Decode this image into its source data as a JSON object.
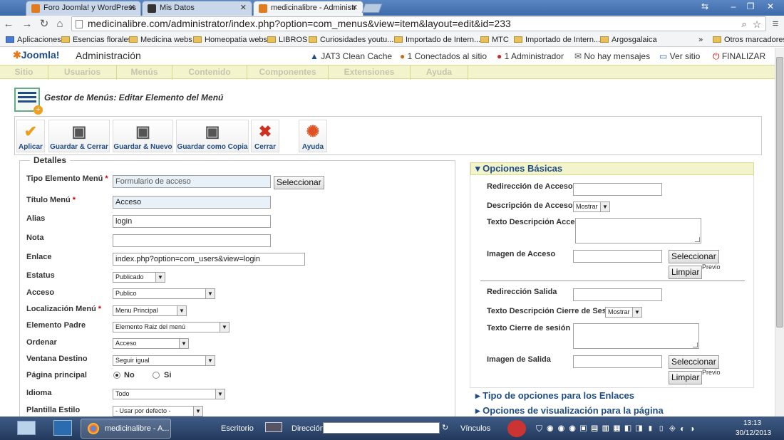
{
  "browser": {
    "tabs": [
      {
        "label": "Foro Joomla! y WordPress"
      },
      {
        "label": "Mis Datos"
      },
      {
        "label": "medicinalibre - Administr"
      }
    ],
    "url": "medicinalibre.com/administrator/index.php?option=com_menus&view=item&layout=edit&id=233",
    "bookmarks": [
      "Aplicaciones",
      "Esencias florales",
      "Medicina webs",
      "Homeopatia webs",
      "LIBROS",
      "Curiosidades youtu...",
      "Importado de Intern...",
      "MTC",
      "Importado de Intern...",
      "Argosgalaica"
    ],
    "other_bookmarks": "Otros marcadores"
  },
  "joomla": {
    "logo": "Joomla!",
    "admin": "Administración",
    "header_links": [
      "JAT3 Clean Cache",
      "1 Conectados al sitio",
      "1 Administrador",
      "No hay mensajes",
      "Ver sitio",
      "FINALIZAR"
    ],
    "menu": [
      "Sitio",
      "Usuarios",
      "Menús",
      "Contenido",
      "Componentes",
      "Extensiones",
      "Ayuda"
    ],
    "page_title": "Gestor de Menús: Editar Elemento del Menú",
    "toolbar": [
      "Aplicar",
      "Guardar & Cerrar",
      "Guardar & Nuevo",
      "Guardar como Copia",
      "Cerrar",
      "Ayuda"
    ]
  },
  "details": {
    "legend": "Detalles",
    "labels": {
      "tipo": "Tipo Elemento Menú",
      "titulo": "Título Menú",
      "alias": "Alias",
      "nota": "Nota",
      "enlace": "Enlace",
      "estatus": "Estatus",
      "acceso": "Acceso",
      "localizacion": "Localización Menú",
      "padre": "Elemento Padre",
      "ordenar": "Ordenar",
      "ventana": "Ventana Destino",
      "principal": "Página principal",
      "idioma": "Idioma",
      "plantilla": "Plantilla Estilo"
    },
    "values": {
      "tipo": "Formulario de acceso",
      "titulo": "Acceso",
      "alias": "login",
      "nota": "",
      "enlace": "index.php?option=com_users&view=login",
      "estatus": "Publicado",
      "acceso": "Publico",
      "localizacion": "Menu Principal",
      "padre": "Elemento Raiz del menú",
      "ordenar": "Acceso",
      "ventana": "Seguir igual",
      "idioma": "Todo",
      "plantilla": "- Usar por defecto -"
    },
    "principal_options": [
      "No",
      "Si"
    ],
    "select_button": "Seleccionar"
  },
  "options": {
    "basic_title": "Opciones Básicas",
    "labels": {
      "redir_acceso": "Redirección de Acceso",
      "desc_acceso": "Descripción de Acceso",
      "texto_desc_acceso": "Texto Descripción Acceso",
      "imagen_acceso": "Imagen de Acceso",
      "redir_salida": "Redirección Salida",
      "texto_desc_cierre": "Texto Descripción Cierre de Sesión",
      "texto_cierre": "Texto Cierre de sesión",
      "imagen_salida": "Imagen de Salida"
    },
    "mostrar": "Mostrar",
    "seleccionar": "Seleccionar",
    "limpiar": "Limpiar",
    "previo": "Previo",
    "panels": [
      "Tipo de opciones para los Enlaces",
      "Opciones de visualización para la página"
    ]
  },
  "taskbar": {
    "app": "medicinalibre - A...",
    "escritorio": "Escritorio",
    "direccion": "Dirección",
    "vinculos": "Vínculos",
    "time": "13:13",
    "date": "30/12/2013"
  }
}
